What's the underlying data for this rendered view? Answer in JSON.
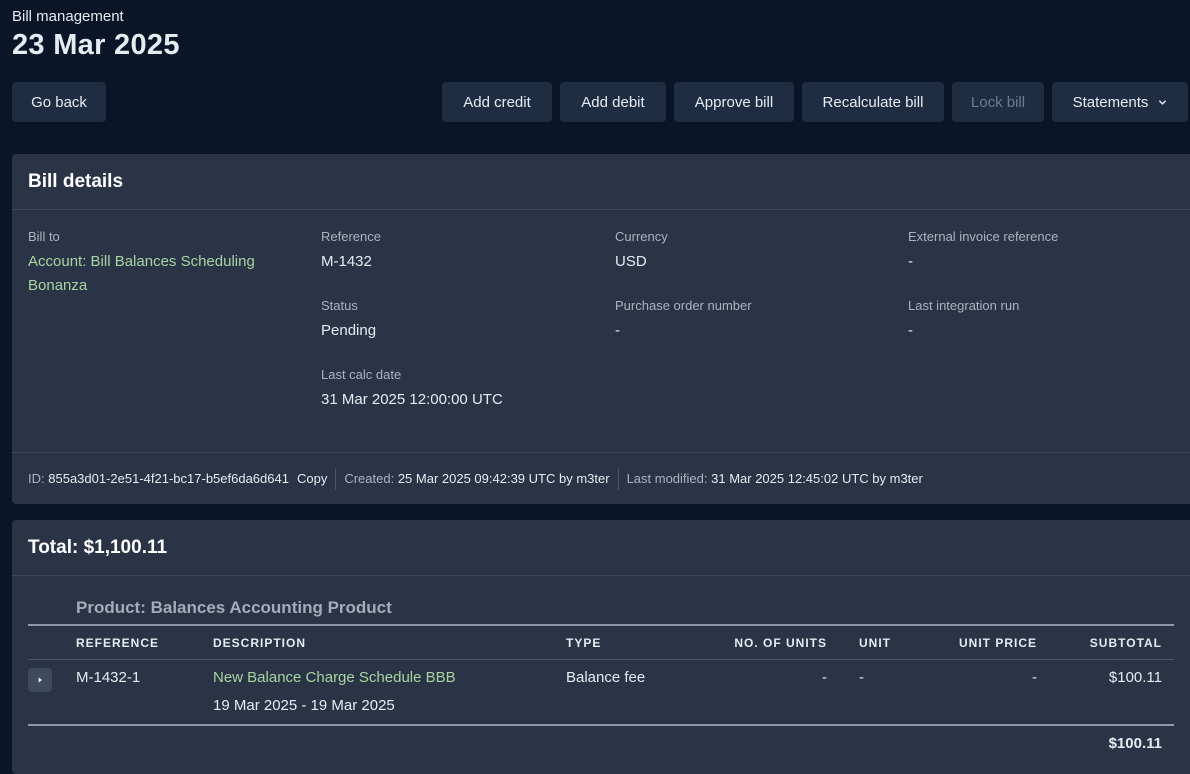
{
  "header": {
    "breadcrumb": "Bill management",
    "date": "23 Mar 2025"
  },
  "toolbar": {
    "go_back": "Go back",
    "add_credit": "Add credit",
    "add_debit": "Add debit",
    "approve_bill": "Approve bill",
    "recalculate_bill": "Recalculate bill",
    "lock_bill": "Lock bill",
    "statements": "Statements"
  },
  "details": {
    "title": "Bill details",
    "bill_to_label": "Bill to",
    "bill_to_value": "Account: Bill Balances Scheduling Bonanza",
    "reference_label": "Reference",
    "reference_value": "M-1432",
    "status_label": "Status",
    "status_value": "Pending",
    "last_calc_label": "Last calc date",
    "last_calc_value": "31 Mar 2025 12:00:00 UTC",
    "currency_label": "Currency",
    "currency_value": "USD",
    "po_label": "Purchase order number",
    "po_value": "-",
    "ext_ref_label": "External invoice reference",
    "ext_ref_value": "-",
    "last_integration_label": "Last integration run",
    "last_integration_value": "-",
    "meta": {
      "id_label": "ID:",
      "id_value": "855a3d01-2e51-4f21-bc17-b5ef6da6d641",
      "copy_label": "Copy",
      "created_label": "Created:",
      "created_value": "25 Mar 2025 09:42:39 UTC by m3ter",
      "modified_label": "Last modified:",
      "modified_value": "31 Mar 2025 12:45:02 UTC by m3ter"
    }
  },
  "total": {
    "title": "Total: $1,100.11",
    "product_title": "Product: Balances Accounting Product",
    "columns": {
      "reference": "REFERENCE",
      "description": "DESCRIPTION",
      "type": "TYPE",
      "units": "NO. OF UNITS",
      "unit": "UNIT",
      "unit_price": "UNIT PRICE",
      "subtotal": "SUBTOTAL"
    },
    "rows": [
      {
        "reference": "M-1432-1",
        "description": "New Balance Charge Schedule BBB",
        "date_range": "19 Mar 2025 - 19 Mar 2025",
        "type": "Balance fee",
        "units": "-",
        "unit": "-",
        "unit_price": "-",
        "subtotal": "$100.11"
      }
    ],
    "product_subtotal": "$100.11"
  },
  "colors": {
    "background": "#0a1628",
    "panel": "#2b3446",
    "button": "#1f2d42",
    "link": "#a7d4a1"
  }
}
